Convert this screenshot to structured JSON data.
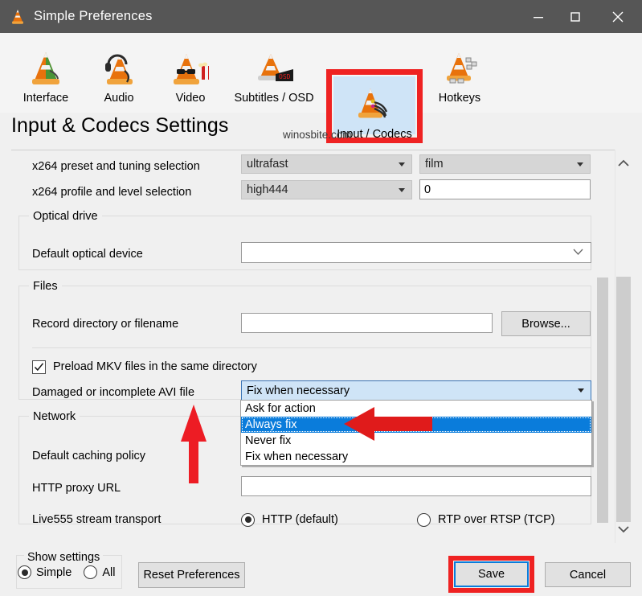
{
  "window": {
    "title": "Simple Preferences",
    "icon": "vlc-cone-icon",
    "controls": {
      "minimize": "–",
      "maximize": "☐",
      "close": "✕"
    }
  },
  "toolbar": {
    "tabs": [
      {
        "id": "interface",
        "label": "Interface",
        "icon": "vlc-cone-green-icon",
        "selected": false
      },
      {
        "id": "audio",
        "label": "Audio",
        "icon": "vlc-cone-headphones-icon",
        "selected": false
      },
      {
        "id": "video",
        "label": "Video",
        "icon": "vlc-cone-glasses-popcorn-icon",
        "selected": false
      },
      {
        "id": "subtitles",
        "label": "Subtitles / OSD",
        "icon": "vlc-cone-subtitles-icon",
        "selected": false
      },
      {
        "id": "input",
        "label": "Input / Codecs",
        "icon": "vlc-cone-cables-icon",
        "selected": true
      },
      {
        "id": "hotkeys",
        "label": "Hotkeys",
        "icon": "vlc-cone-keyboard-icon",
        "selected": false
      }
    ]
  },
  "page": {
    "heading": "Input & Codecs Settings",
    "watermark": "winosbite.com"
  },
  "codecs": {
    "preset_label": "x264 preset and tuning selection",
    "preset_value": "ultrafast",
    "tuning_value": "film",
    "profile_label": "x264 profile and level selection",
    "profile_value": "high444",
    "level_value": "0"
  },
  "optical": {
    "group_title": "Optical drive",
    "device_label": "Default optical device",
    "device_value": ""
  },
  "files": {
    "group_title": "Files",
    "record_label": "Record directory or filename",
    "record_value": "",
    "browse_label": "Browse...",
    "preload_label": "Preload MKV files in the same directory",
    "preload_checked": true,
    "avi_label": "Damaged or incomplete AVI file",
    "avi_selected": "Fix when necessary",
    "avi_options": [
      {
        "label": "Ask for action",
        "highlighted": false
      },
      {
        "label": "Always fix",
        "highlighted": true
      },
      {
        "label": "Never fix",
        "highlighted": false
      },
      {
        "label": "Fix when necessary",
        "highlighted": false
      }
    ]
  },
  "network": {
    "group_title": "Network",
    "caching_label": "Default caching policy",
    "proxy_label": "HTTP proxy URL",
    "proxy_value": "",
    "live555_label": "Live555 stream transport",
    "live555_options": [
      {
        "label": "HTTP (default)",
        "selected": true
      },
      {
        "label": "RTP over RTSP (TCP)",
        "selected": false
      }
    ]
  },
  "footer": {
    "show_settings_title": "Show settings",
    "show_settings_options": [
      {
        "label": "Simple",
        "selected": true
      },
      {
        "label": "All",
        "selected": false
      }
    ],
    "reset_label": "Reset Preferences",
    "save_label": "Save",
    "cancel_label": "Cancel"
  },
  "annotations": {
    "highlight_color": "#ef2222",
    "arrow_up_target": "Damaged or incomplete AVI file",
    "arrow_left_target": "Always fix",
    "boxed_tab": "Input / Codecs",
    "boxed_button": "Save"
  }
}
